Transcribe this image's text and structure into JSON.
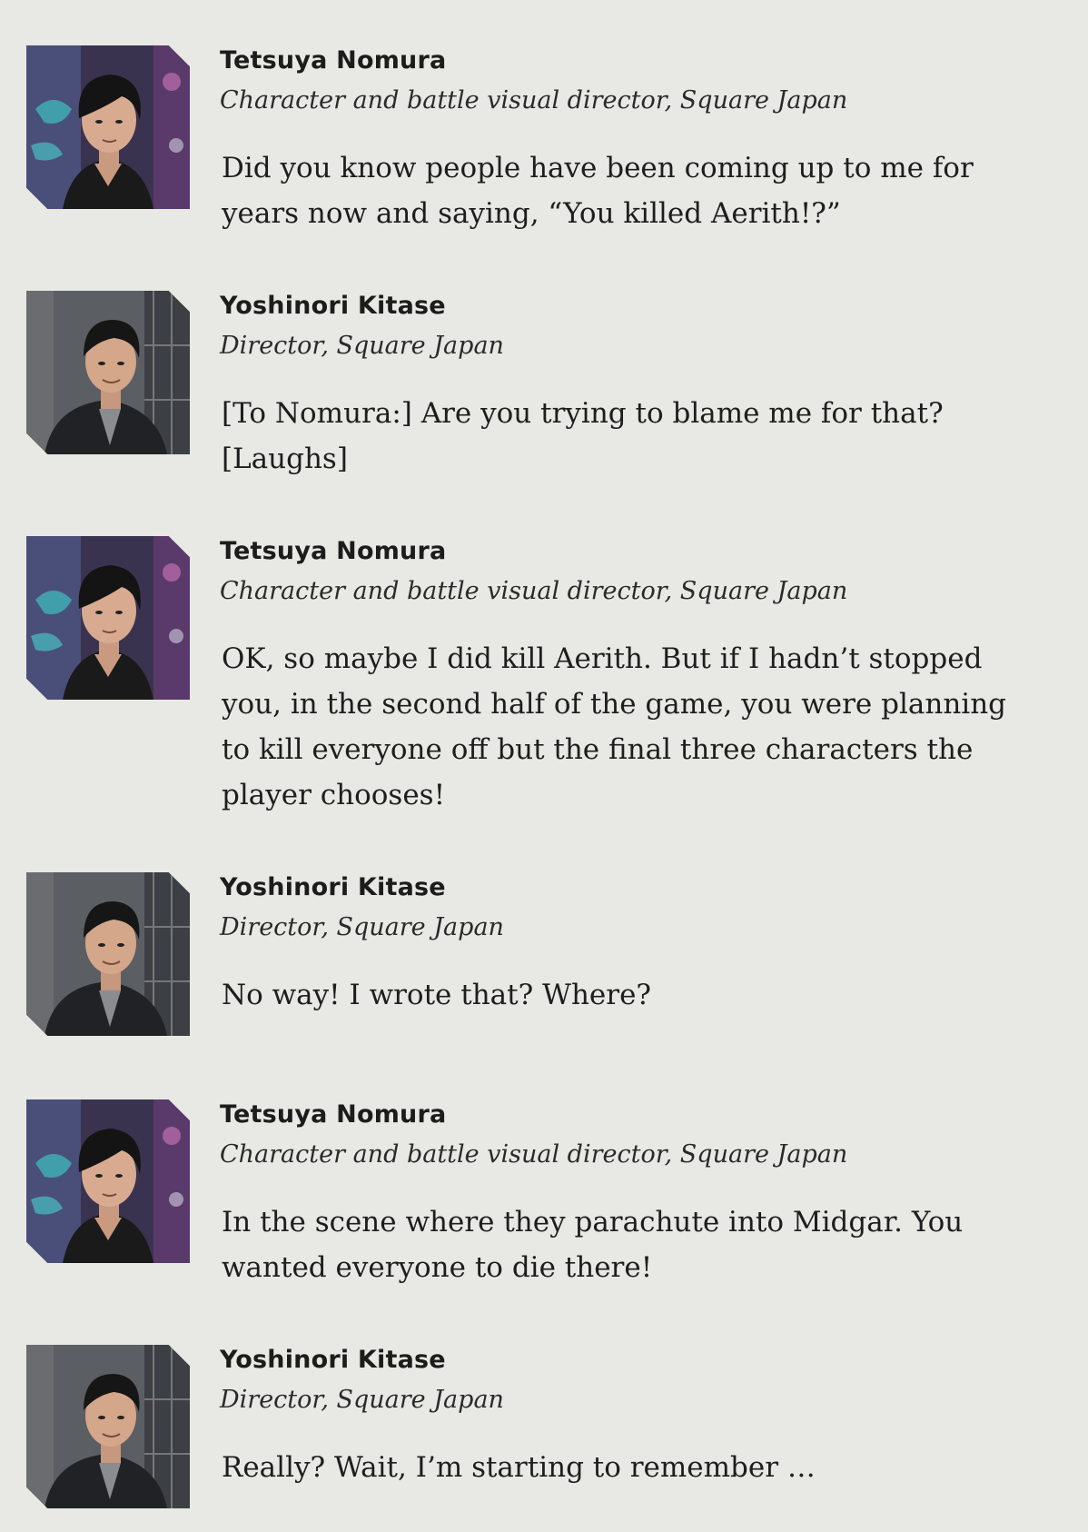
{
  "entries": [
    {
      "speaker": "Tetsuya Nomura",
      "role": "Character and battle visual director, Square Japan",
      "avatar_icon": "nomura-portrait",
      "quote": "Did you know people have been coming up to me for years now and saying, “You killed Aerith!?”"
    },
    {
      "speaker": "Yoshinori Kitase",
      "role": "Director, Square Japan",
      "avatar_icon": "kitase-portrait",
      "quote": "[To Nomura:] Are you trying to blame me for that? [Laughs]"
    },
    {
      "speaker": "Tetsuya Nomura",
      "role": "Character and battle visual director, Square Japan",
      "avatar_icon": "nomura-portrait",
      "quote": "OK, so maybe I did kill Aerith. But if I hadn’t stopped you, in the second half of the game, you were planning to kill everyone off but the final three characters the player chooses!"
    },
    {
      "speaker": "Yoshinori Kitase",
      "role": "Director, Square Japan",
      "avatar_icon": "kitase-portrait",
      "quote": "No way! I wrote that? Where?"
    },
    {
      "speaker": "Tetsuya Nomura",
      "role": "Character and battle visual director, Square Japan",
      "avatar_icon": "nomura-portrait",
      "quote": "In the scene where they parachute into Midgar. You wanted everyone to die there!"
    },
    {
      "speaker": "Yoshinori Kitase",
      "role": "Director, Square Japan",
      "avatar_icon": "kitase-portrait",
      "quote": "Really? Wait, I’m starting to remember …"
    }
  ]
}
